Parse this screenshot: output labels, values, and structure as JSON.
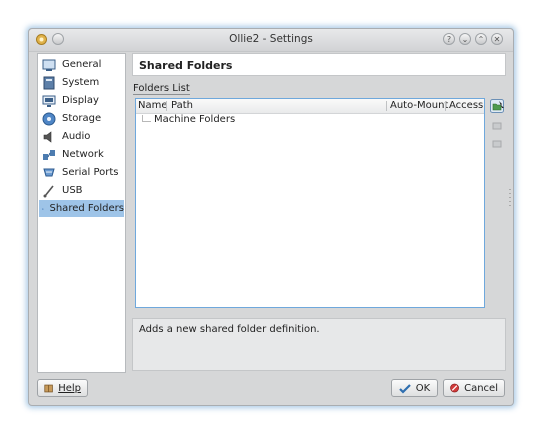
{
  "window": {
    "title": "Ollie2 - Settings",
    "title_buttons": [
      "?",
      "⌄",
      "⌃",
      "✕"
    ]
  },
  "sidebar": {
    "items": [
      {
        "label": "General",
        "icon": "general-icon"
      },
      {
        "label": "System",
        "icon": "system-icon"
      },
      {
        "label": "Display",
        "icon": "display-icon"
      },
      {
        "label": "Storage",
        "icon": "storage-icon"
      },
      {
        "label": "Audio",
        "icon": "audio-icon"
      },
      {
        "label": "Network",
        "icon": "network-icon"
      },
      {
        "label": "Serial Ports",
        "icon": "serial-ports-icon"
      },
      {
        "label": "USB",
        "icon": "usb-icon"
      },
      {
        "label": "Shared Folders",
        "icon": "shared-folders-icon",
        "selected": true
      }
    ]
  },
  "main": {
    "header_title": "Shared Folders",
    "folders_list_label": "Folders List",
    "columns": [
      "Name",
      "Path",
      "Auto-Mount",
      "Access"
    ],
    "tree_root": "Machine Folders",
    "description": "Adds a new shared folder definition."
  },
  "buttons": {
    "help": "Help",
    "ok": "OK",
    "cancel": "Cancel"
  },
  "colors": {
    "selection": "#9ec4e8",
    "list_border": "#6fa8dc",
    "window_bg": "#d6d7d8"
  }
}
